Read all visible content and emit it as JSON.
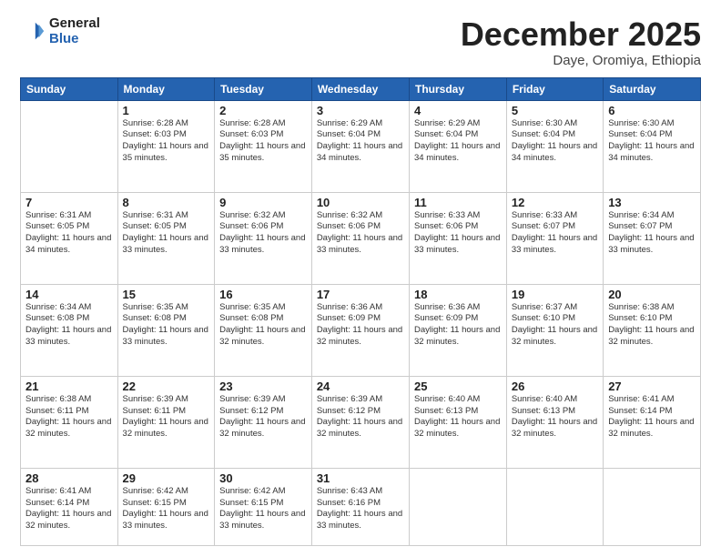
{
  "logo": {
    "general": "General",
    "blue": "Blue"
  },
  "title": "December 2025",
  "subtitle": "Daye, Oromiya, Ethiopia",
  "weekdays": [
    "Sunday",
    "Monday",
    "Tuesday",
    "Wednesday",
    "Thursday",
    "Friday",
    "Saturday"
  ],
  "weeks": [
    [
      {
        "day": "",
        "empty": true
      },
      {
        "day": "1",
        "sunrise": "6:28 AM",
        "sunset": "6:03 PM",
        "daylight": "11 hours and 35 minutes."
      },
      {
        "day": "2",
        "sunrise": "6:28 AM",
        "sunset": "6:03 PM",
        "daylight": "11 hours and 35 minutes."
      },
      {
        "day": "3",
        "sunrise": "6:29 AM",
        "sunset": "6:04 PM",
        "daylight": "11 hours and 34 minutes."
      },
      {
        "day": "4",
        "sunrise": "6:29 AM",
        "sunset": "6:04 PM",
        "daylight": "11 hours and 34 minutes."
      },
      {
        "day": "5",
        "sunrise": "6:30 AM",
        "sunset": "6:04 PM",
        "daylight": "11 hours and 34 minutes."
      },
      {
        "day": "6",
        "sunrise": "6:30 AM",
        "sunset": "6:04 PM",
        "daylight": "11 hours and 34 minutes."
      }
    ],
    [
      {
        "day": "7",
        "sunrise": "6:31 AM",
        "sunset": "6:05 PM",
        "daylight": "11 hours and 34 minutes."
      },
      {
        "day": "8",
        "sunrise": "6:31 AM",
        "sunset": "6:05 PM",
        "daylight": "11 hours and 33 minutes."
      },
      {
        "day": "9",
        "sunrise": "6:32 AM",
        "sunset": "6:06 PM",
        "daylight": "11 hours and 33 minutes."
      },
      {
        "day": "10",
        "sunrise": "6:32 AM",
        "sunset": "6:06 PM",
        "daylight": "11 hours and 33 minutes."
      },
      {
        "day": "11",
        "sunrise": "6:33 AM",
        "sunset": "6:06 PM",
        "daylight": "11 hours and 33 minutes."
      },
      {
        "day": "12",
        "sunrise": "6:33 AM",
        "sunset": "6:07 PM",
        "daylight": "11 hours and 33 minutes."
      },
      {
        "day": "13",
        "sunrise": "6:34 AM",
        "sunset": "6:07 PM",
        "daylight": "11 hours and 33 minutes."
      }
    ],
    [
      {
        "day": "14",
        "sunrise": "6:34 AM",
        "sunset": "6:08 PM",
        "daylight": "11 hours and 33 minutes."
      },
      {
        "day": "15",
        "sunrise": "6:35 AM",
        "sunset": "6:08 PM",
        "daylight": "11 hours and 33 minutes."
      },
      {
        "day": "16",
        "sunrise": "6:35 AM",
        "sunset": "6:08 PM",
        "daylight": "11 hours and 32 minutes."
      },
      {
        "day": "17",
        "sunrise": "6:36 AM",
        "sunset": "6:09 PM",
        "daylight": "11 hours and 32 minutes."
      },
      {
        "day": "18",
        "sunrise": "6:36 AM",
        "sunset": "6:09 PM",
        "daylight": "11 hours and 32 minutes."
      },
      {
        "day": "19",
        "sunrise": "6:37 AM",
        "sunset": "6:10 PM",
        "daylight": "11 hours and 32 minutes."
      },
      {
        "day": "20",
        "sunrise": "6:38 AM",
        "sunset": "6:10 PM",
        "daylight": "11 hours and 32 minutes."
      }
    ],
    [
      {
        "day": "21",
        "sunrise": "6:38 AM",
        "sunset": "6:11 PM",
        "daylight": "11 hours and 32 minutes."
      },
      {
        "day": "22",
        "sunrise": "6:39 AM",
        "sunset": "6:11 PM",
        "daylight": "11 hours and 32 minutes."
      },
      {
        "day": "23",
        "sunrise": "6:39 AM",
        "sunset": "6:12 PM",
        "daylight": "11 hours and 32 minutes."
      },
      {
        "day": "24",
        "sunrise": "6:39 AM",
        "sunset": "6:12 PM",
        "daylight": "11 hours and 32 minutes."
      },
      {
        "day": "25",
        "sunrise": "6:40 AM",
        "sunset": "6:13 PM",
        "daylight": "11 hours and 32 minutes."
      },
      {
        "day": "26",
        "sunrise": "6:40 AM",
        "sunset": "6:13 PM",
        "daylight": "11 hours and 32 minutes."
      },
      {
        "day": "27",
        "sunrise": "6:41 AM",
        "sunset": "6:14 PM",
        "daylight": "11 hours and 32 minutes."
      }
    ],
    [
      {
        "day": "28",
        "sunrise": "6:41 AM",
        "sunset": "6:14 PM",
        "daylight": "11 hours and 32 minutes."
      },
      {
        "day": "29",
        "sunrise": "6:42 AM",
        "sunset": "6:15 PM",
        "daylight": "11 hours and 33 minutes."
      },
      {
        "day": "30",
        "sunrise": "6:42 AM",
        "sunset": "6:15 PM",
        "daylight": "11 hours and 33 minutes."
      },
      {
        "day": "31",
        "sunrise": "6:43 AM",
        "sunset": "6:16 PM",
        "daylight": "11 hours and 33 minutes."
      },
      {
        "day": "",
        "empty": true
      },
      {
        "day": "",
        "empty": true
      },
      {
        "day": "",
        "empty": true
      }
    ]
  ]
}
